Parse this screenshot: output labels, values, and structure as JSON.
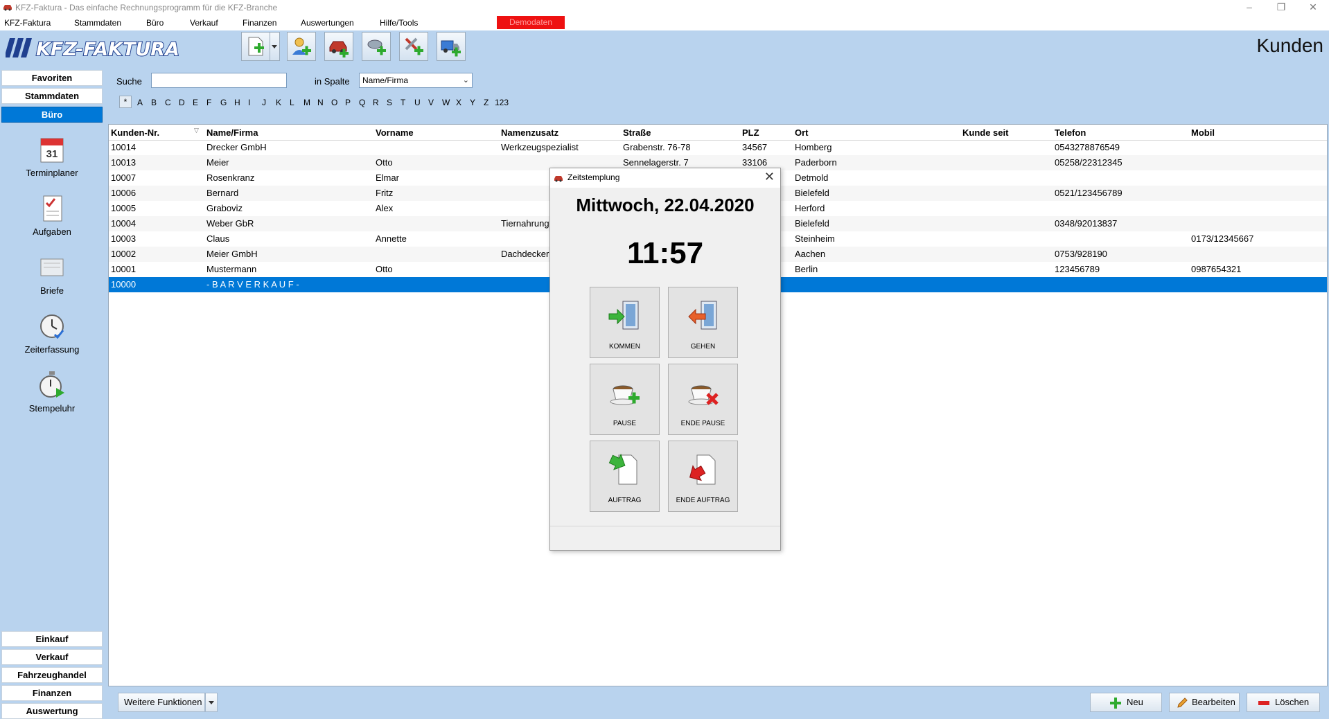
{
  "window": {
    "title": "KFZ-Faktura - Das einfache Rechnungsprogramm für die KFZ-Branche"
  },
  "menu": [
    "KFZ-Faktura",
    "Stammdaten",
    "Büro",
    "Verkauf",
    "Finanzen",
    "Auswertungen",
    "Hilfe/Tools"
  ],
  "demo_badge": "Demodaten",
  "logo_text": "KFZ-FAKTURA",
  "page_title": "Kunden",
  "sidebar": {
    "top": [
      "Favoriten",
      "Stammdaten",
      "Büro"
    ],
    "active": "Büro",
    "items": [
      "Terminplaner",
      "Aufgaben",
      "Briefe",
      "Zeiterfassung",
      "Stempeluhr"
    ],
    "bottom": [
      "Einkauf",
      "Verkauf",
      "Fahrzeughandel",
      "Finanzen",
      "Auswertung"
    ]
  },
  "search": {
    "label": "Suche",
    "value": "",
    "column_label": "in Spalte",
    "column_value": "Name/Firma"
  },
  "alphabet": [
    "*",
    "A",
    "B",
    "C",
    "D",
    "E",
    "F",
    "G",
    "H",
    "I",
    "J",
    "K",
    "L",
    "M",
    "N",
    "O",
    "P",
    "Q",
    "R",
    "S",
    "T",
    "U",
    "V",
    "W",
    "X",
    "Y",
    "Z",
    "123"
  ],
  "table": {
    "columns": [
      "Kunden-Nr.",
      "Name/Firma",
      "Vorname",
      "Namenzusatz",
      "Straße",
      "PLZ",
      "Ort",
      "Kunde seit",
      "Telefon",
      "Mobil"
    ],
    "rows": [
      [
        "10014",
        "Drecker GmbH",
        "",
        "Werkzeugspezialist",
        "Grabenstr. 76-78",
        "34567",
        "Homberg",
        "",
        "0543278876549",
        ""
      ],
      [
        "10013",
        "Meier",
        "Otto",
        "",
        "Sennelagerstr. 7",
        "33106",
        "Paderborn",
        "",
        "05258/22312345",
        ""
      ],
      [
        "10007",
        "Rosenkranz",
        "Elmar",
        "",
        "",
        "",
        "Detmold",
        "",
        "",
        ""
      ],
      [
        "10006",
        "Bernard",
        "Fritz",
        "",
        "",
        "",
        "Bielefeld",
        "",
        "0521/123456789",
        ""
      ],
      [
        "10005",
        "Graboviz",
        "Alex",
        "",
        "",
        "",
        "Herford",
        "",
        "",
        ""
      ],
      [
        "10004",
        "Weber GbR",
        "",
        "Tiernahrung",
        "",
        "",
        "Bielefeld",
        "",
        "0348/92013837",
        ""
      ],
      [
        "10003",
        "Claus",
        "Annette",
        "",
        "",
        "",
        "Steinheim",
        "",
        "",
        "0173/12345667"
      ],
      [
        "10002",
        "Meier GmbH",
        "",
        "Dachdecker",
        "",
        "",
        "Aachen",
        "",
        "0753/928190",
        ""
      ],
      [
        "10001",
        "Mustermann",
        "Otto",
        "",
        "",
        "",
        "Berlin",
        "",
        "123456789",
        "0987654321"
      ],
      [
        "10000",
        "- B A R V E R K A U F -",
        "",
        "",
        "",
        "",
        "",
        "",
        "",
        ""
      ]
    ],
    "selected_row": 9
  },
  "bottom": {
    "more_functions": "Weitere Funktionen",
    "new": "Neu",
    "edit": "Bearbeiten",
    "delete": "Löschen"
  },
  "dialog": {
    "title": "Zeitstemplung",
    "date": "Mittwoch, 22.04.2020",
    "time": "11:57",
    "buttons": [
      "KOMMEN",
      "GEHEN",
      "PAUSE",
      "ENDE PAUSE",
      "AUFTRAG",
      "ENDE AUFTRAG"
    ]
  },
  "colors": {
    "accent": "#0078d7",
    "background": "#b9d3ee",
    "demo": "#ee1111"
  }
}
